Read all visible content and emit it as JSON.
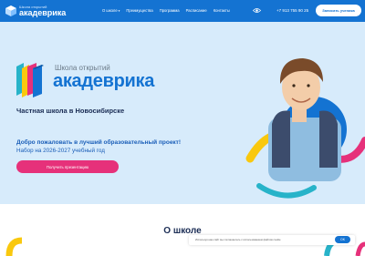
{
  "header": {
    "logo_small": "Школа открытий",
    "logo_big": "акадеврика",
    "nav": [
      {
        "label": "О школе"
      },
      {
        "label": "Преимущества"
      },
      {
        "label": "Программа"
      },
      {
        "label": "Расписание"
      },
      {
        "label": "Контакты"
      }
    ],
    "accessibility_icon": "eye-icon",
    "phone": "+7 913 755 90 25",
    "cta_label": "Записать ученика"
  },
  "hero": {
    "school_label": "Школа открытий",
    "brand_name": "акадеврика",
    "tagline": "Частная школа в Новосибирске",
    "welcome": "Добро пожаловать в лучший образовательный проект!",
    "enroll_text": "Набор на 2026-2027 учебный год",
    "cta_label": "Получить презентацию"
  },
  "about": {
    "title": "О школе"
  },
  "cookie": {
    "text": "Используя наш сайт вы соглашаетесь с использованием файлов cookie",
    "ok_label": "OK"
  },
  "colors": {
    "brand_blue": "#1473d2",
    "hero_bg": "#d7ebfb",
    "accent_pink": "#e6317a",
    "accent_yellow": "#f9c80e",
    "heading_navy": "#1a2c54"
  }
}
